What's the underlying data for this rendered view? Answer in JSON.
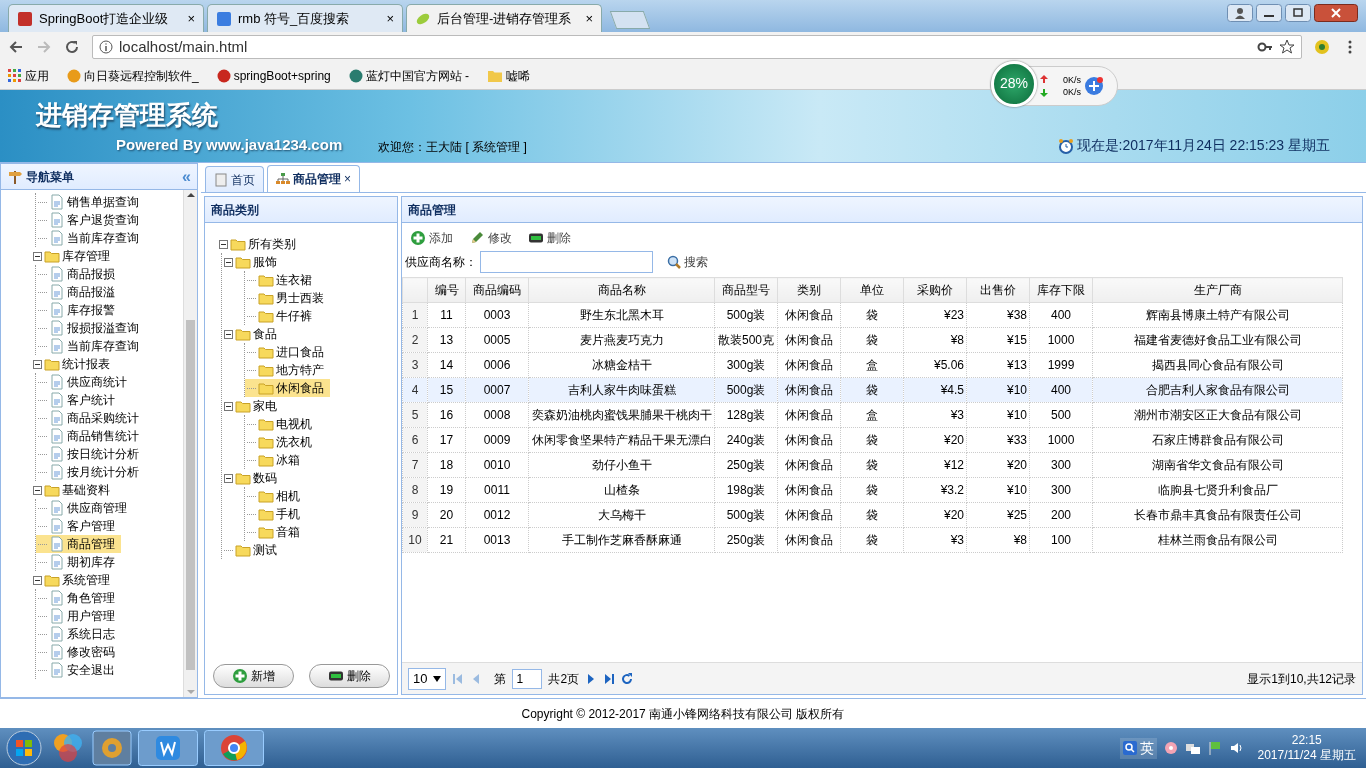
{
  "browser": {
    "tabs": [
      {
        "title": "SpringBoot打造企业级",
        "selected": false,
        "close": "×"
      },
      {
        "title": "rmb 符号_百度搜索",
        "selected": false,
        "close": "×"
      },
      {
        "title": "后台管理-进销存管理系",
        "selected": true,
        "close": "×"
      }
    ],
    "address": "localhost/main.html",
    "monitor": {
      "percent": "28%",
      "upload": "0K/s",
      "download": "0K/s"
    },
    "bookmarks": [
      "应用",
      "向日葵远程控制软件_",
      "springBoot+spring",
      "蓝灯中国官方网站 -",
      "嘘唏"
    ]
  },
  "header": {
    "title": "进销存管理系统",
    "powered_by": "Powered By www.java1234.com",
    "welcome": "欢迎您：王大陆 [ 系统管理 ]",
    "clock": "现在是:2017年11月24日 22:15:23 星期五"
  },
  "nav": {
    "title": "导航菜单",
    "collapse": "«",
    "items": [
      {
        "children": [
          {
            "label": "销售单据查询",
            "selected": false
          },
          {
            "label": "客户退货查询",
            "selected": false
          },
          {
            "label": "当前库存查询",
            "selected": false
          }
        ]
      },
      {
        "label": "库存管理",
        "expanded": true,
        "children": [
          {
            "label": "商品报损",
            "selected": false
          },
          {
            "label": "商品报溢",
            "selected": false
          },
          {
            "label": "库存报警",
            "selected": false
          },
          {
            "label": "报损报溢查询",
            "selected": false
          },
          {
            "label": "当前库存查询",
            "selected": false
          }
        ]
      },
      {
        "label": "统计报表",
        "expanded": true,
        "children": [
          {
            "label": "供应商统计",
            "selected": false
          },
          {
            "label": "客户统计",
            "selected": false
          },
          {
            "label": "商品采购统计",
            "selected": false
          },
          {
            "label": "商品销售统计",
            "selected": false
          },
          {
            "label": "按日统计分析",
            "selected": false
          },
          {
            "label": "按月统计分析",
            "selected": false
          }
        ]
      },
      {
        "label": "基础资料",
        "expanded": true,
        "children": [
          {
            "label": "供应商管理",
            "selected": false
          },
          {
            "label": "客户管理",
            "selected": false
          },
          {
            "label": "商品管理",
            "selected": true
          },
          {
            "label": "期初库存",
            "selected": false
          }
        ]
      },
      {
        "label": "系统管理",
        "expanded": true,
        "children": [
          {
            "label": "角色管理",
            "selected": false
          },
          {
            "label": "用户管理",
            "selected": false
          },
          {
            "label": "系统日志",
            "selected": false
          },
          {
            "label": "修改密码",
            "selected": false
          },
          {
            "label": "安全退出",
            "selected": false
          }
        ]
      }
    ]
  },
  "content_tabs": [
    {
      "label": "首页",
      "selected": false
    },
    {
      "label": "商品管理",
      "selected": true,
      "close": "×"
    }
  ],
  "category": {
    "title": "商品类别",
    "tree": [
      {
        "label": "所有类别",
        "expanded": true,
        "selected": false,
        "children": [
          {
            "label": "服饰",
            "expanded": true,
            "selected": false,
            "children": [
              {
                "label": "连衣裙",
                "selected": false
              },
              {
                "label": "男士西装",
                "selected": false
              },
              {
                "label": "牛仔裤",
                "selected": false
              }
            ]
          },
          {
            "label": "食品",
            "expanded": true,
            "selected": false,
            "children": [
              {
                "label": "进口食品",
                "selected": false
              },
              {
                "label": "地方特产",
                "selected": false
              },
              {
                "label": "休闲食品",
                "selected": true
              }
            ]
          },
          {
            "label": "家电",
            "expanded": true,
            "selected": false,
            "children": [
              {
                "label": "电视机",
                "selected": false
              },
              {
                "label": "洗衣机",
                "selected": false
              },
              {
                "label": "冰箱",
                "selected": false
              }
            ]
          },
          {
            "label": "数码",
            "expanded": true,
            "selected": false,
            "children": [
              {
                "label": "相机",
                "selected": false
              },
              {
                "label": "手机",
                "selected": false
              },
              {
                "label": "音箱",
                "selected": false
              }
            ]
          },
          {
            "label": "测试",
            "selected": false
          }
        ]
      }
    ],
    "buttons": [
      {
        "label": "新增",
        "kind": "add"
      },
      {
        "label": "删除",
        "kind": "remove"
      }
    ]
  },
  "goods": {
    "title": "商品管理",
    "toolbar": [
      {
        "label": "添加",
        "kind": "add"
      },
      {
        "label": "修改",
        "kind": "edit"
      },
      {
        "label": "删除",
        "kind": "remove"
      }
    ],
    "search": {
      "label": "供应商名称：",
      "button": "搜索"
    },
    "table": {
      "columns": [
        "编号",
        "商品编码",
        "商品名称",
        "商品型号",
        "类别",
        "单位",
        "采购价",
        "出售价",
        "库存下限",
        "生产厂商"
      ],
      "rows": [
        {
          "number": "1",
          "highlighted": false,
          "cells": [
            "11",
            "0003",
            "野生东北黑木耳",
            "500g装",
            "休闲食品",
            "袋",
            "¥23",
            "¥38",
            "400",
            "辉南县博康土特产有限公司"
          ]
        },
        {
          "number": "2",
          "highlighted": false,
          "cells": [
            "13",
            "0005",
            "麦片燕麦巧克力",
            "散装500克",
            "休闲食品",
            "袋",
            "¥8",
            "¥15",
            "1000",
            "福建省麦德好食品工业有限公司"
          ]
        },
        {
          "number": "3",
          "highlighted": false,
          "cells": [
            "14",
            "0006",
            "冰糖金桔干",
            "300g装",
            "休闲食品",
            "盒",
            "¥5.06",
            "¥13",
            "1999",
            "揭西县同心食品有限公司"
          ]
        },
        {
          "number": "4",
          "highlighted": true,
          "cells": [
            "15",
            "0007",
            "吉利人家牛肉味蛋糕",
            "500g装",
            "休闲食品",
            "袋",
            "¥4.5",
            "¥10",
            "400",
            "合肥吉利人家食品有限公司"
          ]
        },
        {
          "number": "5",
          "highlighted": false,
          "cells": [
            "16",
            "0008",
            "奕森奶油桃肉蜜饯果脯果干桃肉干",
            "128g装",
            "休闲食品",
            "盒",
            "¥3",
            "¥10",
            "500",
            "潮州市潮安区正大食品有限公司"
          ]
        },
        {
          "number": "6",
          "highlighted": false,
          "cells": [
            "17",
            "0009",
            "休闲零食坚果特产精品干果无漂白",
            "240g装",
            "休闲食品",
            "袋",
            "¥20",
            "¥33",
            "1000",
            "石家庄博群食品有限公司"
          ]
        },
        {
          "number": "7",
          "highlighted": false,
          "cells": [
            "18",
            "0010",
            "劲仔小鱼干",
            "250g装",
            "休闲食品",
            "袋",
            "¥12",
            "¥20",
            "300",
            "湖南省华文食品有限公司"
          ]
        },
        {
          "number": "8",
          "highlighted": false,
          "cells": [
            "19",
            "0011",
            "山楂条",
            "198g装",
            "休闲食品",
            "袋",
            "¥3.2",
            "¥10",
            "300",
            "临朐县七贤升利食品厂"
          ]
        },
        {
          "number": "9",
          "highlighted": false,
          "cells": [
            "20",
            "0012",
            "大乌梅干",
            "500g装",
            "休闲食品",
            "袋",
            "¥20",
            "¥25",
            "200",
            "长春市鼎丰真食品有限责任公司"
          ]
        },
        {
          "number": "10",
          "highlighted": false,
          "cells": [
            "21",
            "0013",
            "手工制作芝麻香酥麻通",
            "250g装",
            "休闲食品",
            "袋",
            "¥3",
            "¥8",
            "100",
            "桂林兰雨食品有限公司"
          ]
        }
      ]
    },
    "pager": {
      "page_size": "10",
      "page_prefix": "第",
      "page": "1",
      "page_suffix": "共2页",
      "summary": "显示1到10,共12记录"
    }
  },
  "footer": "Copyright © 2012-2017 南通小锋网络科技有限公司 版权所有",
  "taskbar": {
    "ime": "英",
    "time": "22:15",
    "date": "2017/11/24 星期五"
  }
}
